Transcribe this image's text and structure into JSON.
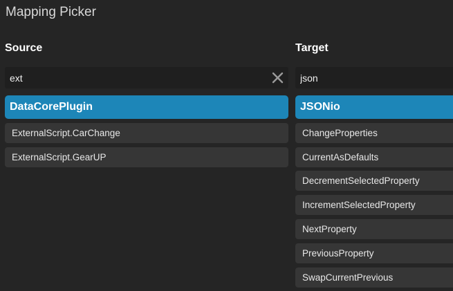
{
  "window": {
    "title": "Mapping Picker"
  },
  "source": {
    "heading": "Source",
    "search": {
      "value": "ext",
      "placeholder": ""
    },
    "group": "DataCorePlugin",
    "items": [
      "ExternalScript.CarChange",
      "ExternalScript.GearUP"
    ]
  },
  "target": {
    "heading": "Target",
    "search": {
      "value": "json",
      "placeholder": ""
    },
    "group": "JSONio",
    "items": [
      "ChangeProperties",
      "CurrentAsDefaults",
      "DecrementSelectedProperty",
      "IncrementSelectedProperty",
      "NextProperty",
      "PreviousProperty",
      "SwapCurrentPrevious"
    ]
  },
  "colors": {
    "background": "#252525",
    "accent": "#1d86b8",
    "item": "#363636",
    "input": "#1f1f1f"
  },
  "icons": {
    "clear": "close-icon"
  }
}
